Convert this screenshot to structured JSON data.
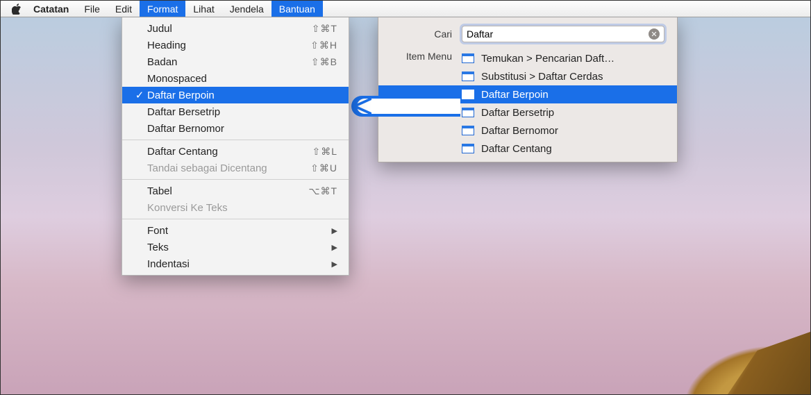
{
  "menubar": {
    "app": "Catatan",
    "items": [
      "File",
      "Edit",
      "Format",
      "Lihat",
      "Jendela",
      "Bantuan"
    ],
    "open_indices": [
      2,
      5
    ]
  },
  "format_menu": {
    "groups": [
      [
        {
          "label": "Judul",
          "shortcut": "⇧⌘T",
          "checked": false,
          "selected": false,
          "disabled": false,
          "sub": false
        },
        {
          "label": "Heading",
          "shortcut": "⇧⌘H",
          "checked": false,
          "selected": false,
          "disabled": false,
          "sub": false
        },
        {
          "label": "Badan",
          "shortcut": "⇧⌘B",
          "checked": false,
          "selected": false,
          "disabled": false,
          "sub": false
        },
        {
          "label": "Monospaced",
          "shortcut": "",
          "checked": false,
          "selected": false,
          "disabled": false,
          "sub": false
        },
        {
          "label": "Daftar Berpoin",
          "shortcut": "",
          "checked": true,
          "selected": true,
          "disabled": false,
          "sub": false
        },
        {
          "label": "Daftar Bersetrip",
          "shortcut": "",
          "checked": false,
          "selected": false,
          "disabled": false,
          "sub": false
        },
        {
          "label": "Daftar Bernomor",
          "shortcut": "",
          "checked": false,
          "selected": false,
          "disabled": false,
          "sub": false
        }
      ],
      [
        {
          "label": "Daftar Centang",
          "shortcut": "⇧⌘L",
          "checked": false,
          "selected": false,
          "disabled": false,
          "sub": false
        },
        {
          "label": "Tandai sebagai Dicentang",
          "shortcut": "⇧⌘U",
          "checked": false,
          "selected": false,
          "disabled": true,
          "sub": false
        }
      ],
      [
        {
          "label": "Tabel",
          "shortcut": "⌥⌘T",
          "checked": false,
          "selected": false,
          "disabled": false,
          "sub": false
        },
        {
          "label": "Konversi Ke Teks",
          "shortcut": "",
          "checked": false,
          "selected": false,
          "disabled": true,
          "sub": false
        }
      ],
      [
        {
          "label": "Font",
          "shortcut": "",
          "checked": false,
          "selected": false,
          "disabled": false,
          "sub": true
        },
        {
          "label": "Teks",
          "shortcut": "",
          "checked": false,
          "selected": false,
          "disabled": false,
          "sub": true
        },
        {
          "label": "Indentasi",
          "shortcut": "",
          "checked": false,
          "selected": false,
          "disabled": false,
          "sub": true
        }
      ]
    ]
  },
  "help_panel": {
    "search_label": "Cari",
    "search_value": "Daftar",
    "menu_label": "Item Menu",
    "results": [
      {
        "label": "Temukan > Pencarian Daft…",
        "selected": false
      },
      {
        "label": "Substitusi > Daftar Cerdas",
        "selected": false
      },
      {
        "label": "Daftar Berpoin",
        "selected": true
      },
      {
        "label": "Daftar Bersetrip",
        "selected": false
      },
      {
        "label": "Daftar Bernomor",
        "selected": false
      },
      {
        "label": "Daftar Centang",
        "selected": false
      }
    ]
  }
}
